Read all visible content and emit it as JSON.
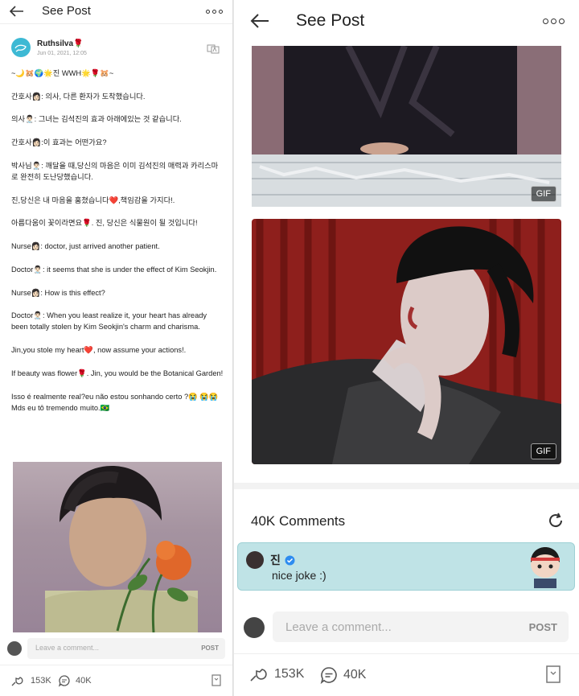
{
  "left": {
    "header": {
      "title": "See Post"
    },
    "post": {
      "author": "Ruthsilva🌹",
      "date": "Jun 01, 2021, 12:05",
      "paragraphs": [
        "~🌙🐹🌍🌟진 WWH🌟🌹🐹~",
        "간호사👩🏻: 의사, 다른 환자가 도착했습니다.",
        "의사👨🏻‍⚕️: 그녀는 김석진의 효과 아래에있는 것 같습니다.",
        "간호사👩🏻:이 효과는 어떤가요?",
        "박사님👨🏻‍⚕️: 깨달을 때,당신의 마음은 이미 김석진의 매력과 카리스마로 완전히 도난당했습니다.",
        "진,당신은 내 마음을 훔쳤습니다❤️,책임감을 가지다!.",
        "아름다움이 꽃이라면요🌹. 진, 당신은 식물원이 될 것입니다!",
        "Nurse👩🏻: doctor, just arrived another patient.",
        "Doctor👨🏻‍⚕️: it seems that she is under the effect of Kim Seokjin.",
        "Nurse👩🏻: How is this effect?",
        "Doctor👨🏻‍⚕️: When you least realize it, your heart has already been totally stolen by Kim Seokjin's charm and charisma.",
        "Jin,you stole my heart❤️, now assume your actions!.",
        "If beauty was flower🌹. Jin, you would be the Botanical Garden!",
        "Isso é realmente real?eu não estou sonhando certo ?😭 😭😭Mds eu tô tremendo muito.🇧🇷"
      ]
    },
    "comment_box": {
      "placeholder": "Leave a comment...",
      "post_label": "POST"
    },
    "actions": {
      "likes": "153K",
      "comments": "40K"
    }
  },
  "right": {
    "header": {
      "title": "See Post"
    },
    "gif_badge_1": "GIF",
    "gif_badge_2": "GIF",
    "comments_header": "40K Comments",
    "featured_comment": {
      "name": "진",
      "text": "nice joke :)"
    },
    "comment_box": {
      "placeholder": "Leave a comment...",
      "post_label": "POST"
    },
    "actions": {
      "likes": "153K",
      "comments": "40K"
    }
  },
  "colors": {
    "featured_bg": "#bfe3e6",
    "verified": "#2d8cf0",
    "avatar": "#3db9d4"
  }
}
